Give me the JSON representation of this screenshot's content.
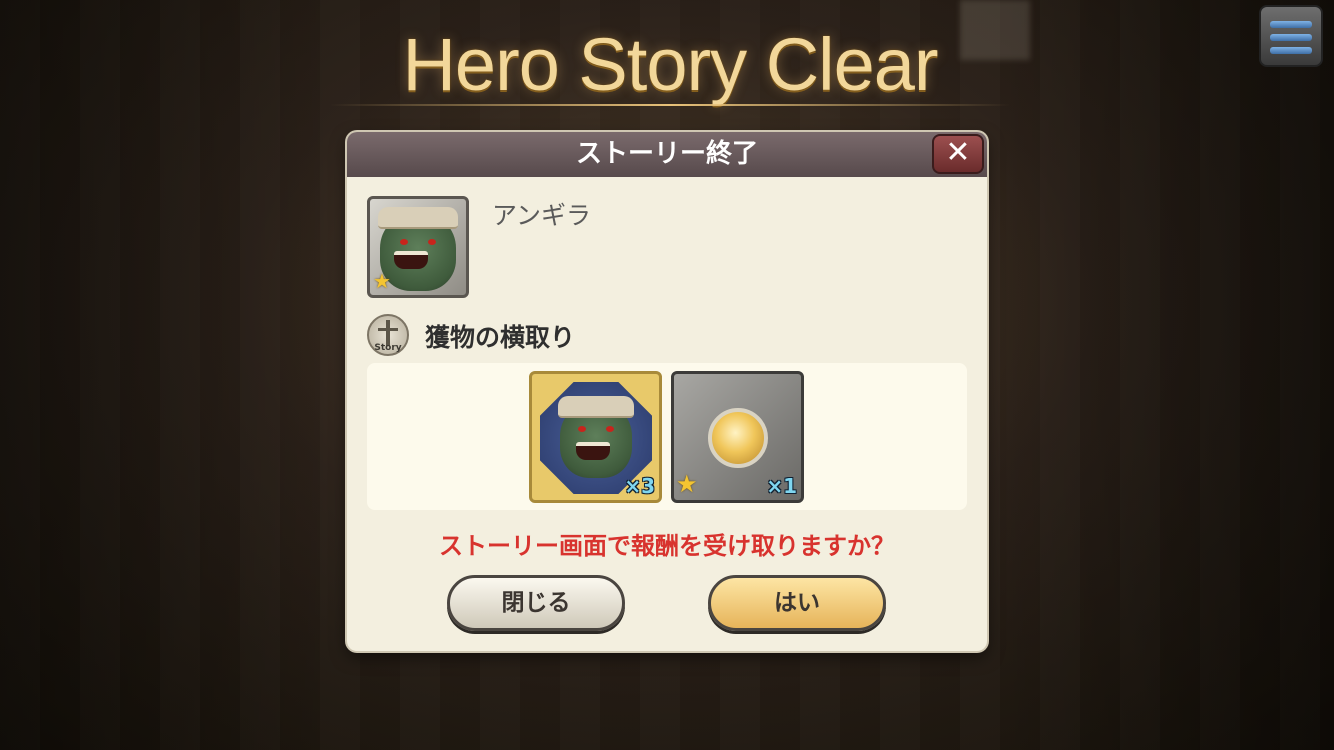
{
  "banner": {
    "title": "Hero Story Clear"
  },
  "menu": {
    "icon": "hamburger-icon"
  },
  "dialog": {
    "title": "ストーリー終了",
    "close_icon": "close-icon",
    "hero": {
      "name": "アンギラ",
      "stars": 1
    },
    "story": {
      "icon_tag": "Story",
      "name": "獲物の横取り"
    },
    "rewards": [
      {
        "kind": "hero",
        "count": "×3"
      },
      {
        "kind": "coin",
        "count": "×1",
        "stars": 1
      }
    ],
    "question": "ストーリー画面で報酬を受け取りますか？",
    "buttons": {
      "close": "閉じる",
      "yes": "はい"
    }
  },
  "colors": {
    "title_gold": "#f2d79a",
    "question_red": "#d8332e",
    "yes_button": "#e6b45a",
    "header": "#6a5c5e"
  }
}
